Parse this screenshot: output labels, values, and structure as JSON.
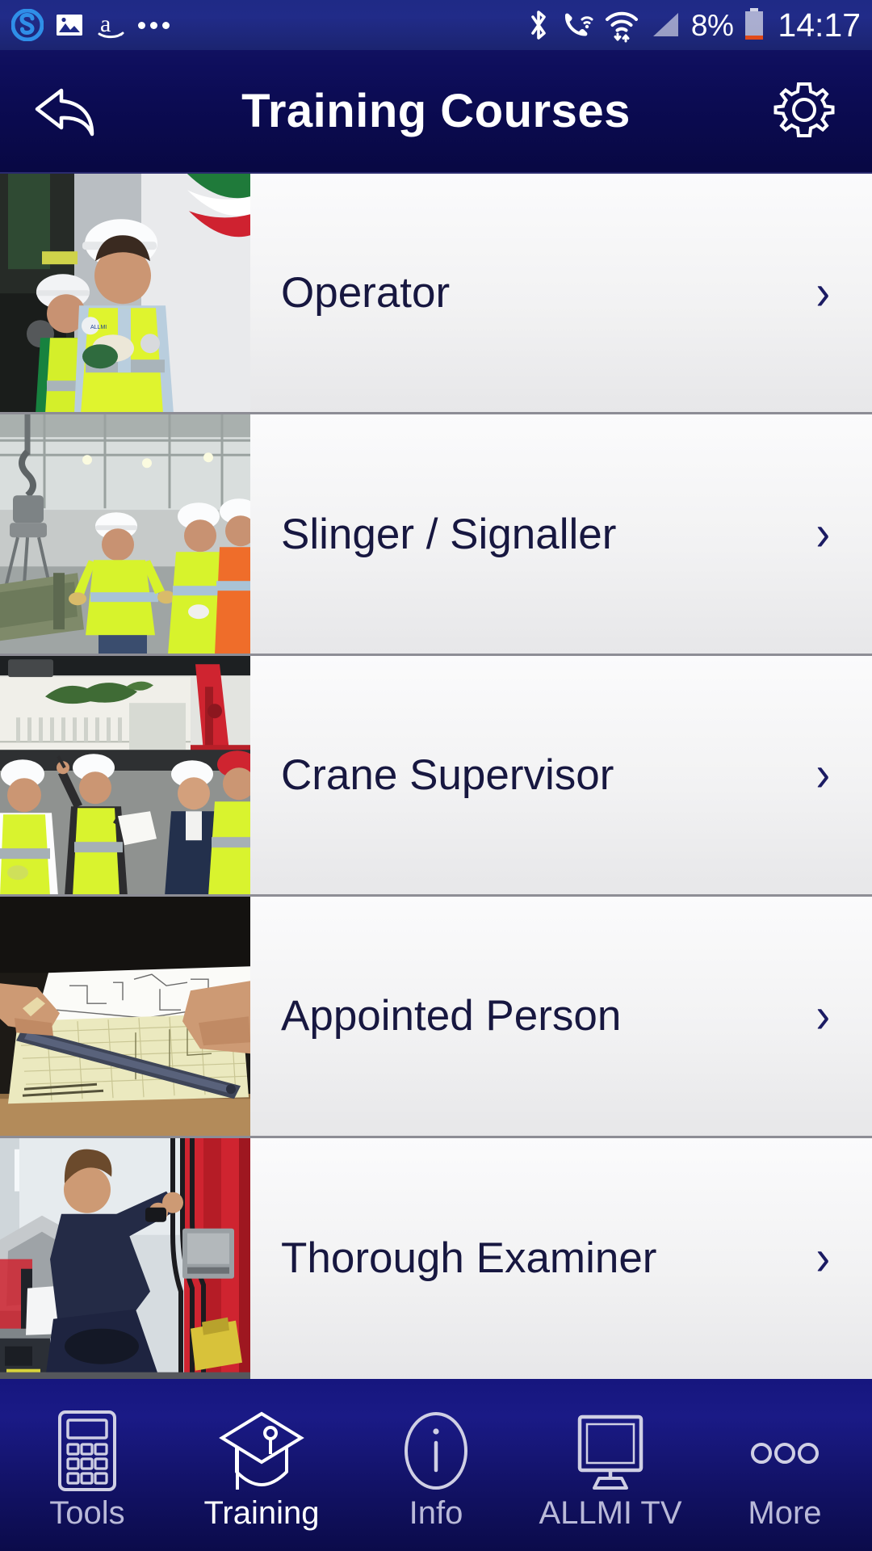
{
  "statusbar": {
    "left_icons": [
      {
        "name": "skype-icon",
        "glyph": "S"
      },
      {
        "name": "gallery-icon",
        "glyph": "photo"
      },
      {
        "name": "amazon-icon",
        "glyph": "a"
      },
      {
        "name": "more-notifications-icon",
        "glyph": "..."
      }
    ],
    "right_icons": [
      {
        "name": "bluetooth-icon"
      },
      {
        "name": "wifi-calling-icon"
      },
      {
        "name": "wifi-icon"
      },
      {
        "name": "cellular-signal-icon"
      }
    ],
    "battery_percent": "8%",
    "clock": "14:17"
  },
  "header": {
    "title": "Training Courses",
    "back_label": "Back",
    "settings_label": "Settings"
  },
  "list": {
    "items": [
      {
        "label": "Operator",
        "chevron": "›",
        "thumb_alt": "Two workers in hi-vis vests and white hard hats operating crane controls beside a truck"
      },
      {
        "label": "Slinger / Signaller",
        "chevron": "›",
        "thumb_alt": "Workers in hi-vis jackets in a warehouse with a crane hook and chain sling lifting a load"
      },
      {
        "label": "Crane Supervisor",
        "chevron": "›",
        "thumb_alt": "Group of workers in hi-vis vests and hard hats outdoors beside a red crane, one pointing upward"
      },
      {
        "label": "Appointed Person",
        "chevron": "›",
        "thumb_alt": "Hands using a ruler on technical lift-plan drawings and graph paper on a wooden desk"
      },
      {
        "label": "Thorough Examiner",
        "chevron": "›",
        "thumb_alt": "Technician in navy overalls inspecting hydraulic hoses on a red truck-mounted crane"
      }
    ]
  },
  "tabbar": {
    "active": "Training",
    "tabs": [
      {
        "label": "Tools",
        "icon": "calculator-icon"
      },
      {
        "label": "Training",
        "icon": "graduation-cap-icon"
      },
      {
        "label": "Info",
        "icon": "info-circle-icon"
      },
      {
        "label": "ALLMI TV",
        "icon": "monitor-icon"
      },
      {
        "label": "More",
        "icon": "ellipsis-icon"
      }
    ]
  },
  "colors": {
    "header_navy": "#0b0b52",
    "statusbar_blue": "#212b88",
    "tabbar_blue": "#1a1a86",
    "row_text_navy": "#171740",
    "chevron_navy": "#1b1b63",
    "separator_gray": "#8d8d95",
    "battery_red": "#e04a1a"
  }
}
